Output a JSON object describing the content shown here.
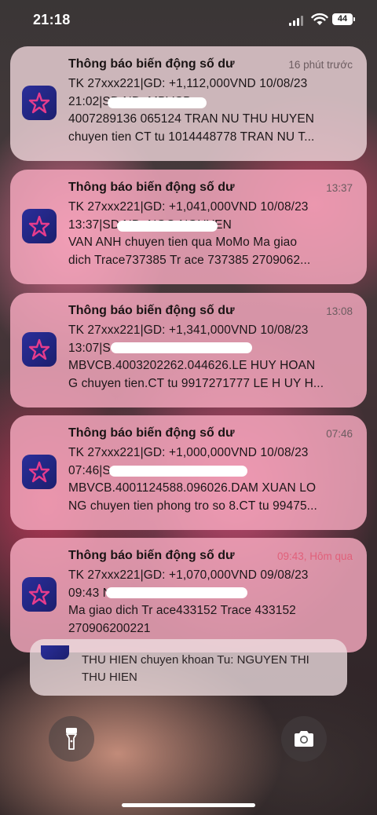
{
  "status_bar": {
    "time": "21:18",
    "battery": "44"
  },
  "notifications": [
    {
      "title": "Thông báo biến động số dư",
      "time": "16 phút trước",
      "body": "TK 27xxx221|GD: +1,112,000VND 10/08/23\n21:02|SD               ND: MBVCB\n4007289136 065124 TRAN NU THU HUYEN\nchuyen tien CT tu 1014448778 TRAN NU T..."
    },
    {
      "title": "Thông báo biến động số dư",
      "time": "13:37",
      "body": "TK 27xxx221|GD: +1,041,000VND 10/08/23\n13:37|SD               ND: NGO NGUYEN\nVAN ANH chuyen tien qua MoMo Ma giao\ndich Trace737385 Tr ace 737385 2709062..."
    },
    {
      "title": "Thông báo biến động số dư",
      "time": "13:08",
      "body": "TK 27xxx221|GD: +1,341,000VND 10/08/23\n13:07|S\nMBVCB.4003202262.044626.LE HUY HOAN\nG chuyen tien.CT tu 9917271777 LE H UY H..."
    },
    {
      "title": "Thông báo biến động số dư",
      "time": "07:46",
      "body": "TK 27xxx221|GD: +1,000,000VND 10/08/23\n07:46|S\nMBVCB.4001124588.096026.DAM XUAN LO\nNG chuyen tien phong tro so 8.CT tu 99475..."
    },
    {
      "title": "Thông báo biến động số dư",
      "time": "09:43, Hôm qua",
      "body": "TK 27xxx221|GD: +1,070,000VND 09/08/23\n09:43                   ND: chi thanh ck nha\nMa giao dich Tr ace433152 Trace 433152\n270906200221"
    }
  ],
  "stacked_notification": {
    "text": "THU HIEN chuyen khoan Tu: NGUYEN THI\nTHU HIEN"
  },
  "controls": {
    "flashlight": "flashlight-icon",
    "camera": "camera-icon"
  },
  "colors": {
    "app_icon": "#1c1f6e",
    "yesterday_time": "#e0607a"
  }
}
